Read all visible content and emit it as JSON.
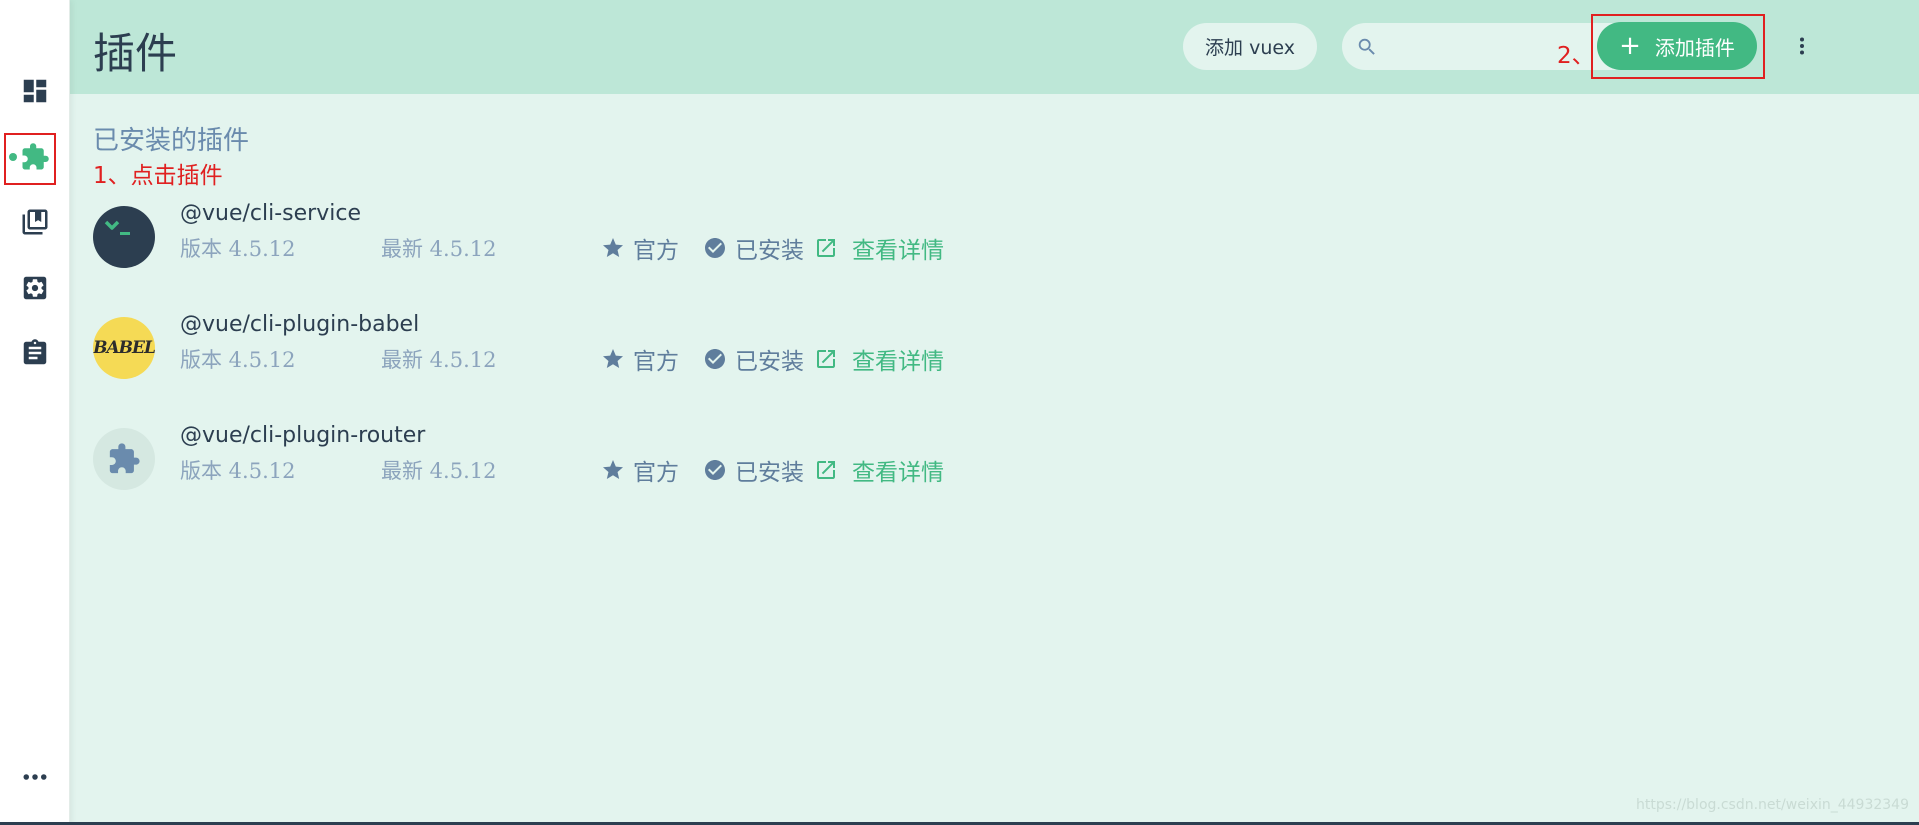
{
  "header": {
    "title": "插件",
    "vuex_button": "添加 vuex",
    "search_placeholder": "",
    "add_button": "添加插件",
    "add_plus": "+"
  },
  "annotations": {
    "step1": "1、点击插件",
    "step2": "2、"
  },
  "main": {
    "section_title": "已安装的插件",
    "plugins": [
      {
        "name": "@vue/cli-service",
        "version": "版本 4.5.12",
        "latest": "最新 4.5.12",
        "official": "官方",
        "installed": "已安装",
        "details": "查看详情"
      },
      {
        "name": "@vue/cli-plugin-babel",
        "version": "版本 4.5.12",
        "latest": "最新 4.5.12",
        "official": "官方",
        "installed": "已安装",
        "details": "查看详情",
        "logo_text": "BABEL"
      },
      {
        "name": "@vue/cli-plugin-router",
        "version": "版本 4.5.12",
        "latest": "最新 4.5.12",
        "official": "官方",
        "installed": "已安装",
        "details": "查看详情"
      }
    ]
  },
  "sidebar": {
    "items": [
      {
        "icon": "dashboard-icon"
      },
      {
        "icon": "puzzle-icon",
        "active": true
      },
      {
        "icon": "library-icon"
      },
      {
        "icon": "settings-icon"
      },
      {
        "icon": "clipboard-icon"
      },
      {
        "icon": "more-horiz-icon"
      }
    ]
  },
  "watermark": "https://blog.csdn.net/weixin_44932349",
  "colors": {
    "accent": "#42b983",
    "header_bg": "#bde7d7",
    "main_bg": "#e3f4ee",
    "text_dark": "#2c3e50",
    "text_muted": "#8ca4bd",
    "annotation": "#e02020"
  }
}
